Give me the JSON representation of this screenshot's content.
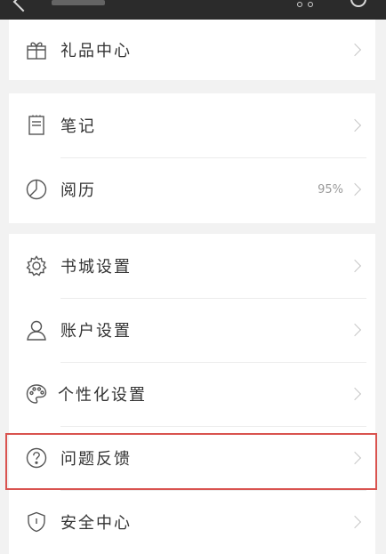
{
  "menu": {
    "gift_center": "礼品中心",
    "notes": "笔记",
    "reading_history": "阅历",
    "reading_history_value": "95%",
    "store_settings": "书城设置",
    "account_settings": "账户设置",
    "personalization": "个性化设置",
    "feedback": "问题反馈",
    "security_center": "安全中心"
  },
  "colors": {
    "highlight_border": "#d9534f",
    "topbar_bg": "#2b2b2b",
    "page_bg": "#f2f2f2"
  },
  "icons": {
    "gift_center": "gift-icon",
    "notes": "notebook-icon",
    "reading_history": "pie-chart-icon",
    "store_settings": "gear-icon",
    "account_settings": "user-icon",
    "personalization": "palette-icon",
    "feedback": "question-circle-icon",
    "security_center": "shield-icon"
  }
}
